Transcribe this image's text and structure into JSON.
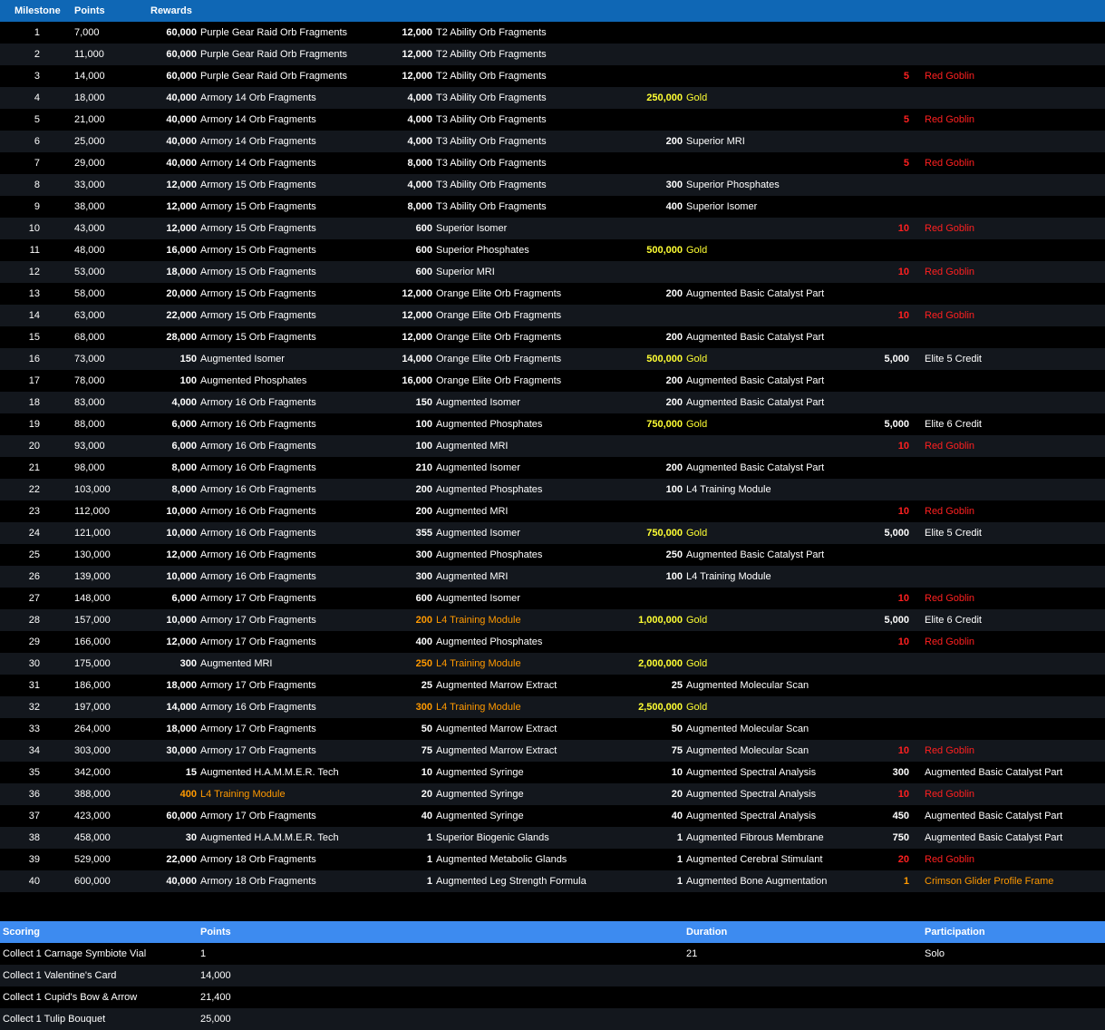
{
  "milestones": {
    "headers": [
      "Milestone",
      "Points",
      "Rewards"
    ],
    "colors": {
      "white": "#ffffff",
      "red": "#ff2020",
      "yellow": "#ffff33",
      "orange": "#ff9900"
    },
    "rows": [
      {
        "m": "1",
        "p": "7,000",
        "r": [
          {
            "q": "60,000",
            "n": "Purple Gear Raid Orb Fragments"
          },
          {
            "q": "12,000",
            "n": "T2 Ability Orb Fragments"
          },
          null,
          null
        ]
      },
      {
        "m": "2",
        "p": "11,000",
        "r": [
          {
            "q": "60,000",
            "n": "Purple Gear Raid Orb Fragments"
          },
          {
            "q": "12,000",
            "n": "T2 Ability Orb Fragments"
          },
          null,
          null
        ]
      },
      {
        "m": "3",
        "p": "14,000",
        "r": [
          {
            "q": "60,000",
            "n": "Purple Gear Raid Orb Fragments"
          },
          {
            "q": "12,000",
            "n": "T2 Ability Orb Fragments"
          },
          null,
          {
            "q": "5",
            "n": "Red Goblin",
            "c": "red"
          }
        ]
      },
      {
        "m": "4",
        "p": "18,000",
        "r": [
          {
            "q": "40,000",
            "n": "Armory 14 Orb Fragments"
          },
          {
            "q": "4,000",
            "n": "T3 Ability Orb Fragments"
          },
          {
            "q": "250,000",
            "n": "Gold",
            "c": "yellow"
          },
          null
        ]
      },
      {
        "m": "5",
        "p": "21,000",
        "r": [
          {
            "q": "40,000",
            "n": "Armory 14 Orb Fragments"
          },
          {
            "q": "4,000",
            "n": "T3 Ability Orb Fragments"
          },
          null,
          {
            "q": "5",
            "n": "Red Goblin",
            "c": "red"
          }
        ]
      },
      {
        "m": "6",
        "p": "25,000",
        "r": [
          {
            "q": "40,000",
            "n": "Armory 14 Orb Fragments"
          },
          {
            "q": "4,000",
            "n": "T3 Ability Orb Fragments"
          },
          {
            "q": "200",
            "n": "Superior MRI"
          },
          null
        ]
      },
      {
        "m": "7",
        "p": "29,000",
        "r": [
          {
            "q": "40,000",
            "n": "Armory 14 Orb Fragments"
          },
          {
            "q": "8,000",
            "n": "T3 Ability Orb Fragments"
          },
          null,
          {
            "q": "5",
            "n": "Red Goblin",
            "c": "red"
          }
        ]
      },
      {
        "m": "8",
        "p": "33,000",
        "r": [
          {
            "q": "12,000",
            "n": "Armory 15 Orb Fragments"
          },
          {
            "q": "4,000",
            "n": "T3 Ability Orb Fragments"
          },
          {
            "q": "300",
            "n": "Superior Phosphates"
          },
          null
        ]
      },
      {
        "m": "9",
        "p": "38,000",
        "r": [
          {
            "q": "12,000",
            "n": "Armory 15 Orb Fragments"
          },
          {
            "q": "8,000",
            "n": "T3 Ability Orb Fragments"
          },
          {
            "q": "400",
            "n": "Superior Isomer"
          },
          null
        ]
      },
      {
        "m": "10",
        "p": "43,000",
        "r": [
          {
            "q": "12,000",
            "n": "Armory 15 Orb Fragments"
          },
          {
            "q": "600",
            "n": "Superior Isomer"
          },
          null,
          {
            "q": "10",
            "n": "Red Goblin",
            "c": "red"
          }
        ]
      },
      {
        "m": "11",
        "p": "48,000",
        "r": [
          {
            "q": "16,000",
            "n": "Armory 15 Orb Fragments"
          },
          {
            "q": "600",
            "n": "Superior Phosphates"
          },
          {
            "q": "500,000",
            "n": "Gold",
            "c": "yellow"
          },
          null
        ]
      },
      {
        "m": "12",
        "p": "53,000",
        "r": [
          {
            "q": "18,000",
            "n": "Armory 15 Orb Fragments"
          },
          {
            "q": "600",
            "n": "Superior MRI"
          },
          null,
          {
            "q": "10",
            "n": "Red Goblin",
            "c": "red"
          }
        ]
      },
      {
        "m": "13",
        "p": "58,000",
        "r": [
          {
            "q": "20,000",
            "n": "Armory 15 Orb Fragments"
          },
          {
            "q": "12,000",
            "n": "Orange Elite Orb Fragments"
          },
          {
            "q": "200",
            "n": "Augmented Basic Catalyst Part"
          },
          null
        ]
      },
      {
        "m": "14",
        "p": "63,000",
        "r": [
          {
            "q": "22,000",
            "n": "Armory 15 Orb Fragments"
          },
          {
            "q": "12,000",
            "n": "Orange Elite Orb Fragments"
          },
          null,
          {
            "q": "10",
            "n": "Red Goblin",
            "c": "red"
          }
        ]
      },
      {
        "m": "15",
        "p": "68,000",
        "r": [
          {
            "q": "28,000",
            "n": "Armory 15 Orb Fragments"
          },
          {
            "q": "12,000",
            "n": "Orange Elite Orb Fragments"
          },
          {
            "q": "200",
            "n": "Augmented Basic Catalyst Part"
          },
          null
        ]
      },
      {
        "m": "16",
        "p": "73,000",
        "r": [
          {
            "q": "150",
            "n": "Augmented Isomer"
          },
          {
            "q": "14,000",
            "n": "Orange Elite Orb Fragments"
          },
          {
            "q": "500,000",
            "n": "Gold",
            "c": "yellow"
          },
          {
            "q": "5,000",
            "n": "Elite 5 Credit"
          }
        ]
      },
      {
        "m": "17",
        "p": "78,000",
        "r": [
          {
            "q": "100",
            "n": "Augmented Phosphates"
          },
          {
            "q": "16,000",
            "n": "Orange Elite Orb Fragments"
          },
          {
            "q": "200",
            "n": "Augmented Basic Catalyst Part"
          },
          null
        ]
      },
      {
        "m": "18",
        "p": "83,000",
        "r": [
          {
            "q": "4,000",
            "n": "Armory 16 Orb Fragments"
          },
          {
            "q": "150",
            "n": "Augmented Isomer"
          },
          {
            "q": "200",
            "n": "Augmented Basic Catalyst Part"
          },
          null
        ]
      },
      {
        "m": "19",
        "p": "88,000",
        "r": [
          {
            "q": "6,000",
            "n": "Armory 16 Orb Fragments"
          },
          {
            "q": "100",
            "n": "Augmented Phosphates"
          },
          {
            "q": "750,000",
            "n": "Gold",
            "c": "yellow"
          },
          {
            "q": "5,000",
            "n": "Elite 6 Credit"
          }
        ]
      },
      {
        "m": "20",
        "p": "93,000",
        "r": [
          {
            "q": "6,000",
            "n": "Armory 16 Orb Fragments"
          },
          {
            "q": "100",
            "n": "Augmented MRI"
          },
          null,
          {
            "q": "10",
            "n": "Red Goblin",
            "c": "red"
          }
        ]
      },
      {
        "m": "21",
        "p": "98,000",
        "r": [
          {
            "q": "8,000",
            "n": "Armory 16 Orb Fragments"
          },
          {
            "q": "210",
            "n": "Augmented Isomer"
          },
          {
            "q": "200",
            "n": "Augmented Basic Catalyst Part"
          },
          null
        ]
      },
      {
        "m": "22",
        "p": "103,000",
        "r": [
          {
            "q": "8,000",
            "n": "Armory 16 Orb Fragments"
          },
          {
            "q": "200",
            "n": "Augmented Phosphates"
          },
          {
            "q": "100",
            "n": "L4 Training Module"
          },
          null
        ]
      },
      {
        "m": "23",
        "p": "112,000",
        "r": [
          {
            "q": "10,000",
            "n": "Armory 16 Orb Fragments"
          },
          {
            "q": "200",
            "n": "Augmented MRI"
          },
          null,
          {
            "q": "10",
            "n": "Red Goblin",
            "c": "red"
          }
        ]
      },
      {
        "m": "24",
        "p": "121,000",
        "r": [
          {
            "q": "10,000",
            "n": "Armory 16 Orb Fragments"
          },
          {
            "q": "355",
            "n": "Augmented Isomer"
          },
          {
            "q": "750,000",
            "n": "Gold",
            "c": "yellow"
          },
          {
            "q": "5,000",
            "n": "Elite 5 Credit"
          }
        ]
      },
      {
        "m": "25",
        "p": "130,000",
        "r": [
          {
            "q": "12,000",
            "n": "Armory 16 Orb Fragments"
          },
          {
            "q": "300",
            "n": "Augmented Phosphates"
          },
          {
            "q": "250",
            "n": "Augmented Basic Catalyst Part"
          },
          null
        ]
      },
      {
        "m": "26",
        "p": "139,000",
        "r": [
          {
            "q": "10,000",
            "n": "Armory 16 Orb Fragments"
          },
          {
            "q": "300",
            "n": "Augmented MRI"
          },
          {
            "q": "100",
            "n": "L4 Training Module"
          },
          null
        ]
      },
      {
        "m": "27",
        "p": "148,000",
        "r": [
          {
            "q": "6,000",
            "n": "Armory 17 Orb Fragments"
          },
          {
            "q": "600",
            "n": "Augmented Isomer"
          },
          null,
          {
            "q": "10",
            "n": "Red Goblin",
            "c": "red"
          }
        ]
      },
      {
        "m": "28",
        "p": "157,000",
        "r": [
          {
            "q": "10,000",
            "n": "Armory 17 Orb Fragments"
          },
          {
            "q": "200",
            "n": "L4 Training Module",
            "c": "orange"
          },
          {
            "q": "1,000,000",
            "n": "Gold",
            "c": "yellow"
          },
          {
            "q": "5,000",
            "n": "Elite 6 Credit"
          }
        ]
      },
      {
        "m": "29",
        "p": "166,000",
        "r": [
          {
            "q": "12,000",
            "n": "Armory 17 Orb Fragments"
          },
          {
            "q": "400",
            "n": "Augmented Phosphates"
          },
          null,
          {
            "q": "10",
            "n": "Red Goblin",
            "c": "red"
          }
        ]
      },
      {
        "m": "30",
        "p": "175,000",
        "r": [
          {
            "q": "300",
            "n": "Augmented MRI"
          },
          {
            "q": "250",
            "n": "L4 Training Module",
            "c": "orange"
          },
          {
            "q": "2,000,000",
            "n": "Gold",
            "c": "yellow"
          },
          null
        ]
      },
      {
        "m": "31",
        "p": "186,000",
        "r": [
          {
            "q": "18,000",
            "n": "Armory 17 Orb Fragments"
          },
          {
            "q": "25",
            "n": "Augmented Marrow Extract"
          },
          {
            "q": "25",
            "n": "Augmented Molecular Scan"
          },
          null
        ]
      },
      {
        "m": "32",
        "p": "197,000",
        "r": [
          {
            "q": "14,000",
            "n": "Armory 16 Orb Fragments"
          },
          {
            "q": "300",
            "n": "L4 Training Module",
            "c": "orange"
          },
          {
            "q": "2,500,000",
            "n": "Gold",
            "c": "yellow"
          },
          null
        ]
      },
      {
        "m": "33",
        "p": "264,000",
        "r": [
          {
            "q": "18,000",
            "n": "Armory 17 Orb Fragments"
          },
          {
            "q": "50",
            "n": "Augmented Marrow Extract"
          },
          {
            "q": "50",
            "n": "Augmented Molecular Scan"
          },
          null
        ]
      },
      {
        "m": "34",
        "p": "303,000",
        "r": [
          {
            "q": "30,000",
            "n": "Armory 17 Orb Fragments"
          },
          {
            "q": "75",
            "n": "Augmented Marrow Extract"
          },
          {
            "q": "75",
            "n": "Augmented Molecular Scan"
          },
          {
            "q": "10",
            "n": "Red Goblin",
            "c": "red"
          }
        ]
      },
      {
        "m": "35",
        "p": "342,000",
        "r": [
          {
            "q": "15",
            "n": "Augmented H.A.M.M.E.R. Tech"
          },
          {
            "q": "10",
            "n": "Augmented Syringe"
          },
          {
            "q": "10",
            "n": "Augmented Spectral Analysis"
          },
          {
            "q": "300",
            "n": "Augmented Basic Catalyst Part"
          }
        ]
      },
      {
        "m": "36",
        "p": "388,000",
        "r": [
          {
            "q": "400",
            "n": "L4 Training Module",
            "c": "orange"
          },
          {
            "q": "20",
            "n": "Augmented Syringe"
          },
          {
            "q": "20",
            "n": "Augmented Spectral Analysis"
          },
          {
            "q": "10",
            "n": "Red Goblin",
            "c": "red"
          }
        ]
      },
      {
        "m": "37",
        "p": "423,000",
        "r": [
          {
            "q": "60,000",
            "n": "Armory 17 Orb Fragments"
          },
          {
            "q": "40",
            "n": "Augmented Syringe"
          },
          {
            "q": "40",
            "n": "Augmented Spectral Analysis"
          },
          {
            "q": "450",
            "n": "Augmented Basic Catalyst Part"
          }
        ]
      },
      {
        "m": "38",
        "p": "458,000",
        "r": [
          {
            "q": "30",
            "n": "Augmented H.A.M.M.E.R. Tech"
          },
          {
            "q": "1",
            "n": "Superior Biogenic Glands"
          },
          {
            "q": "1",
            "n": "Augmented Fibrous Membrane"
          },
          {
            "q": "750",
            "n": "Augmented Basic Catalyst Part"
          }
        ]
      },
      {
        "m": "39",
        "p": "529,000",
        "r": [
          {
            "q": "22,000",
            "n": "Armory 18 Orb Fragments"
          },
          {
            "q": "1",
            "n": "Augmented Metabolic Glands"
          },
          {
            "q": "1",
            "n": "Augmented Cerebral Stimulant"
          },
          {
            "q": "20",
            "n": "Red Goblin",
            "c": "red"
          }
        ]
      },
      {
        "m": "40",
        "p": "600,000",
        "r": [
          {
            "q": "40,000",
            "n": "Armory 18 Orb Fragments"
          },
          {
            "q": "1",
            "n": "Augmented Leg Strength Formula"
          },
          {
            "q": "1",
            "n": "Augmented Bone Augmentation"
          },
          {
            "q": "1",
            "n": "Crimson Glider Profile Frame",
            "c": "orange"
          }
        ]
      }
    ]
  },
  "scoring": {
    "headers": [
      "Scoring",
      "Points",
      "Duration",
      "Participation"
    ],
    "rows": [
      [
        "Collect 1 Carnage Symbiote Vial",
        "1",
        "21",
        "Solo"
      ],
      [
        "Collect 1 Valentine's Card",
        "14,000",
        "",
        ""
      ],
      [
        "Collect 1 Cupid's Bow & Arrow",
        "21,400",
        "",
        ""
      ],
      [
        "Collect 1 Tulip Bouquet",
        "25,000",
        "",
        ""
      ]
    ]
  }
}
